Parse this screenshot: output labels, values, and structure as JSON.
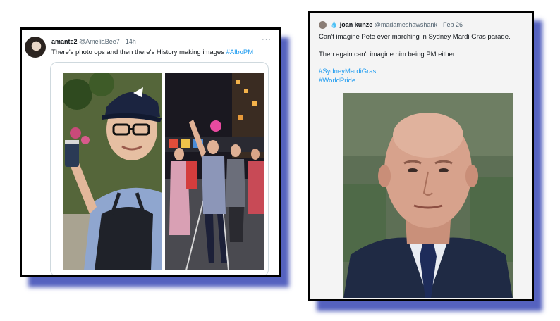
{
  "left_tweet": {
    "display_name": "amante2",
    "handle": "@AmeliaBee7",
    "time": "· 14h",
    "more": "···",
    "text": "There's photo ops and then there's History making images ",
    "hashtag": "#AlboPM",
    "avatar_icon": "user-avatar",
    "images": [
      "man-in-cap-and-apron-photo",
      "night-parade-march-photo"
    ]
  },
  "right_tweet": {
    "display_name": "joan kunze",
    "handle": "@madameshawshank",
    "time": "· Feb 26",
    "name_badge_icon": "water-drop-icon",
    "line1": "Can't imagine Pete ever marching in Sydney Mardi Gras parade.",
    "line2": "Then again can't imagine him being PM either.",
    "hashtag1": "#SydneyMardiGras",
    "hashtag2": "#WorldPride",
    "images": [
      "bald-man-in-suit-photo"
    ]
  },
  "colors": {
    "shadow": "#3746b4",
    "link": "#1d9bf0",
    "text": "#0f1419",
    "muted": "#536471"
  }
}
